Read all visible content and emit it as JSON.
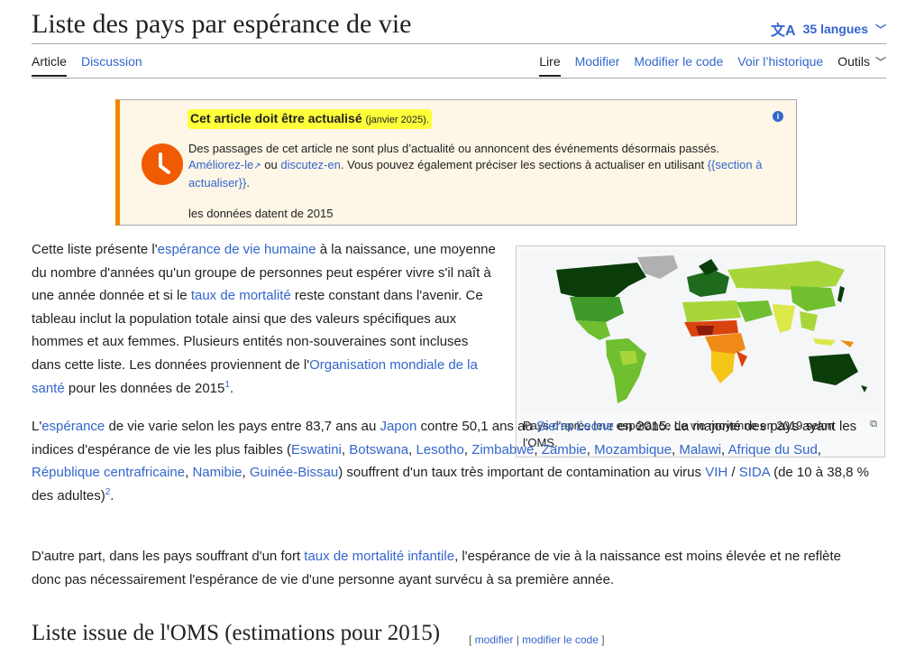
{
  "header": {
    "title": "Liste des pays par espérance de vie",
    "languages": "35 langues"
  },
  "tabs": {
    "left": [
      "Article",
      "Discussion"
    ],
    "right": [
      "Lire",
      "Modifier",
      "Modifier le code",
      "Voir l’historique"
    ],
    "tools": "Outils"
  },
  "notice": {
    "title": "Cet article doit être actualisé",
    "date": "(janvier 2025).",
    "text1": "Des passages de cet article ne sont plus d’actualité ou annoncent des événements désormais passés.",
    "link1": "Améliorez-le",
    "or": "ou",
    "link2": "discutez-en",
    "text2": ". Vous pouvez également préciser les sections à actualiser en utilisant",
    "link3": "{{section à actualiser}}",
    "period": ".",
    "note": "les données datent de 2015"
  },
  "lead": {
    "t1": "Cette liste présente l'",
    "l1": "espérance de vie humaine",
    "t2": " à la naissance, une moyenne du nombre d'années qu'un groupe de personnes peut espérer vivre s'il naît à une année donnée et si le ",
    "l2": "taux de mortalité",
    "t3": " reste constant dans l'avenir. Ce tableau inclut la population totale ainsi que des valeurs spécifiques aux hommes et aux femmes. Plusieurs entités non-souveraines sont incluses dans cette liste. Les données proviennent de l'",
    "l3": "Organisation mondiale de la santé",
    "t4": " pour les données de 2015",
    "ref": "1",
    "t5": "."
  },
  "para2": {
    "t1": "L'",
    "l1": "espérance",
    "t2": " de vie varie selon les pays entre 83,7 ans au ",
    "l2": "Japon",
    "t3": " contre 50,1 ans au ",
    "l3": "Sierra Leone",
    "t4": " en 2015. La majorité des pays ayant les indices d'espérance de vie les plus faibles (",
    "countries": [
      "Eswatini",
      "Botswana",
      "Lesotho",
      "Zimbabwe",
      "Zambie",
      "Mozambique",
      "Malawi",
      "Afrique du Sud",
      "République centrafricaine",
      "Namibie",
      "Guinée-Bissau"
    ],
    "t5": ") souffrent d'un taux très important de contamination au virus ",
    "l4": "VIH",
    "slash": " / ",
    "l5": "SIDA",
    "t6": " (de 10 à 38,8 % des adultes)",
    "ref": "2",
    "t7": "."
  },
  "para3": {
    "t1": "D'autre part, dans les pays souffrant d'un fort ",
    "l1": "taux de mortalité infantile",
    "t2": ", l'espérance de vie à la naissance est moins élevée et ne reflète donc pas nécessairement l'espérance de vie d'une personne ayant survécu à sa première année."
  },
  "figure": {
    "caption": "Pays d'après leur espérance de vie moyenne en 2019 selon l'OMS.",
    "colors": [
      "#0b3d0b",
      "#1e6b1e",
      "#3f9a2a",
      "#6fbf2f",
      "#a8d63a",
      "#dde84a",
      "#f5c518",
      "#f08a16",
      "#d9430f",
      "#8b1a0a",
      "#b0b0b0"
    ]
  },
  "section": {
    "title": "Liste issue de l'OMS (estimations pour 2015)",
    "open": "[",
    "edit": "modifier",
    "sep": " | ",
    "edit_code": "modifier le code",
    "close": "]"
  }
}
